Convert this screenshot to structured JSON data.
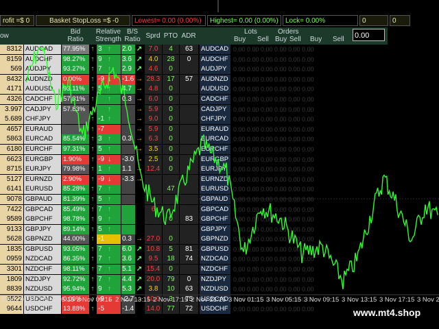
{
  "topbar": {
    "profit": "rofit =$ 0",
    "basket": "Basket StopLoss =$ -0",
    "lowest": "Lowest= 0.00 (0.00%)",
    "highest": "Highest= 0.00 (0.00%)",
    "lock": "Lock= 0.00%",
    "box1": "0",
    "box2": "0"
  },
  "header": {
    "ow": "ow",
    "bid": "Bid\nRatio",
    "rs": "Relative\nStrength",
    "bs": "B/S\nRatio",
    "sprd": "Sprd",
    "pto": "PTO",
    "adr": "ADR",
    "lots": "Lots",
    "orders": "Orders",
    "buy1": "Buy",
    "sell1": "Sell",
    "buy2": "Buy",
    "sell2": "Sell",
    "buy3": "Buy",
    "sell3": "Sell",
    "input_value": "0.00"
  },
  "colors": {
    "green": "#1db954",
    "red": "#e53935",
    "up": "#5cff5c",
    "down": "#ffd000"
  },
  "rows": [
    {
      "num": "8312",
      "sym": "AUDCAD",
      "bid": "77.95%",
      "bidc": "#7a7a7a",
      "rs": "3",
      "rsa": "↑",
      "rsc": "#1fa33a",
      "bs": "2.0",
      "bsc": "#1fa33a",
      "bsa": "↗",
      "sprd": "7.0",
      "sprdc": "#ff4040",
      "pto": "4",
      "ptoc": "#7dff5a",
      "adr": "63",
      "sym2": "AUDCAD",
      "z": "0.00   0.00   0.00   0.00   0.00   0.00"
    },
    {
      "num": "8159",
      "sym": "AUDCHF",
      "bid": "98.27%",
      "bidc": "#1fa33a",
      "rs": "9",
      "rsa": "↑",
      "rsc": "#1fa33a",
      "bs": "3.6",
      "bsc": "#1fa33a",
      "bsa": "↗",
      "sprd": "4.0",
      "sprdc": "#ffd000",
      "pto": "28",
      "ptoc": "#7dff5a",
      "adr": "0",
      "sym2": "AUDCHF",
      "z": "0.00   0.00   0.00   0.00   0.00   0.00"
    },
    {
      "num": "569",
      "sym": "AUDJPY",
      "bid": "93.27%",
      "bidc": "#1fa33a",
      "rs": "7",
      "rsa": "↑",
      "rsc": "#1fa33a",
      "bs": "2.9",
      "bsc": "#1fa33a",
      "bsa": "↗",
      "sprd": "4.6",
      "sprdc": "#ff4040",
      "pto": "0",
      "ptoc": "#7dff5a",
      "adr": "",
      "sym2": "AUDJPY",
      "z": "0.00   0.00   0.00   0.00   0.00   0.00"
    },
    {
      "num": "8432",
      "sym": "AUDNZD",
      "bid": "0.00%",
      "bidc": "#e53935",
      "rs": "-9",
      "rsa": "↓",
      "rsc": "#e53935",
      "bs": "-1.6",
      "bsc": "#e53935",
      "bsa": "→",
      "sprd": "28.3",
      "sprdc": "#ff4040",
      "pto": "17",
      "ptoc": "#7dff5a",
      "adr": "57",
      "sym2": "AUDNZD",
      "z": "0.00   0.00   0.00   0.00   0.00   0.00"
    },
    {
      "num": "4171",
      "sym": "AUDUSD",
      "bid": "93.11%",
      "bidc": "#1fa33a",
      "rs": "5",
      "rsa": "↑",
      "rsc": "#1fa33a",
      "bs": "4.7",
      "bsc": "#1fa33a",
      "bsa": "→",
      "sprd": "4.8",
      "sprdc": "#ff4040",
      "pto": "0",
      "ptoc": "#7dff5a",
      "adr": "",
      "sym2": "AUDUSD",
      "z": "0.00   0.00   0.00   0.00   0.00   0.00"
    },
    {
      "num": "4326",
      "sym": "CADCHF",
      "bid": "57.31%",
      "bidc": "#555555",
      "rs": "",
      "rsa": "↑",
      "rsc": "#1fa33a",
      "bs": "0.3",
      "bsc": "#444444",
      "bsa": "→",
      "sprd": "6.0",
      "sprdc": "#ff4040",
      "pto": "0",
      "ptoc": "#7dff5a",
      "adr": "",
      "sym2": "CADCHF",
      "z": "0.00   0.00   0.00   0.00   0.00   0.00"
    },
    {
      "num": "3.997",
      "sym": "CADJPY",
      "bid": "57.83%",
      "bidc": "#555555",
      "rs": "",
      "rsa": "↑",
      "rsc": "#1fa33a",
      "bs": "",
      "bsc": "#444444",
      "bsa": "→",
      "sprd": "5.9",
      "sprdc": "#ff4040",
      "pto": "0",
      "ptoc": "#7dff5a",
      "adr": "",
      "sym2": "CADJPY",
      "z": "0.00   0.00   0.00   0.00   0.00   0.00"
    },
    {
      "num": "5.689",
      "sym": "CHFJPY",
      "bid": "",
      "bidc": "#555555",
      "rs": "-1",
      "rsa": "↑",
      "rsc": "#1fa33a",
      "bs": "",
      "bsc": "#444444",
      "bsa": "→",
      "sprd": "9.0",
      "sprdc": "#ff4040",
      "pto": "0",
      "ptoc": "#7dff5a",
      "adr": "",
      "sym2": "CHFJPY",
      "z": "0.00   0.00   0.00   0.00   0.00   0.00"
    },
    {
      "num": "4657",
      "sym": "EURAUD",
      "bid": "",
      "bidc": "#555555",
      "rs": "-7",
      "rsa": "",
      "rsc": "#e53935",
      "bs": "",
      "bsc": "#444444",
      "bsa": "→",
      "sprd": "5.9",
      "sprdc": "#ff4040",
      "pto": "0",
      "ptoc": "#7dff5a",
      "adr": "",
      "sym2": "EURAUD",
      "z": "0.00   0.00   0.00   0.00   0.00   0.00"
    },
    {
      "num": "5863",
      "sym": "EURCAD",
      "bid": "85.54%",
      "bidc": "#1fa33a",
      "rs": "3",
      "rsa": "↑",
      "rsc": "#1fa33a",
      "bs": "0.3",
      "bsc": "#444444",
      "bsa": "→",
      "sprd": "6.3",
      "sprdc": "#ff4040",
      "pto": "0",
      "ptoc": "#7dff5a",
      "adr": "",
      "sym2": "EURCAD",
      "z": "0.00   0.00   0.00   0.00   0.00   0.00"
    },
    {
      "num": "6180",
      "sym": "EURCHF",
      "bid": "97.31%",
      "bidc": "#1fa33a",
      "rs": "5",
      "rsa": "↑",
      "rsc": "#1fa33a",
      "bs": "",
      "bsc": "#444444",
      "bsa": "→",
      "sprd": "3.5",
      "sprdc": "#ffd000",
      "pto": "0",
      "ptoc": "#7dff5a",
      "adr": "",
      "sym2": "EURCHF",
      "z": "0.00   0.00   0.00   0.00   0.00   0.00"
    },
    {
      "num": "6623",
      "sym": "EURGBP",
      "bid": "1.90%",
      "bidc": "#e53935",
      "rs": "-9",
      "rsa": "↓",
      "rsc": "#e53935",
      "bs": "-3.0",
      "bsc": "#444444",
      "bsa": "→",
      "sprd": "2.5",
      "sprdc": "#ffd000",
      "pto": "0",
      "ptoc": "#7dff5a",
      "adr": "",
      "sym2": "EURGBP",
      "z": "0.00   0.00   0.00   0.00   0.00   0.00"
    },
    {
      "num": "8715",
      "sym": "EURJPY",
      "bid": "79.98%",
      "bidc": "#555555",
      "rs": "1",
      "rsa": "↑",
      "rsc": "#1fa33a",
      "bs": "1.1",
      "bsc": "#444444",
      "bsa": "→",
      "sprd": "12.4",
      "sprdc": "#ff4040",
      "pto": "0",
      "ptoc": "#7dff5a",
      "adr": "",
      "sym2": "EURJPY",
      "z": "0.00   0.00   0.00   0.00   0.00   0.00"
    },
    {
      "num": "5127",
      "sym": "EURNZD",
      "bid": "2.90%",
      "bidc": "#e53935",
      "rs": "-9",
      "rsa": "↓",
      "rsc": "#e53935",
      "bs": "-3.3",
      "bsc": "#444444",
      "bsa": "→",
      "sprd": "",
      "sprdc": "#ff4040",
      "pto": "",
      "ptoc": "#7dff5a",
      "adr": "",
      "sym2": "EURNZD",
      "z": "0.00   0.00   0.00   0.00   0.00   0.00"
    },
    {
      "num": "6141",
      "sym": "EURUSD",
      "bid": "85.28%",
      "bidc": "#1fa33a",
      "rs": "7",
      "rsa": "↑",
      "rsc": "#1fa33a",
      "bs": "",
      "bsc": "#444444",
      "bsa": "",
      "sprd": "",
      "sprdc": "#ff4040",
      "pto": "47",
      "ptoc": "#7dff5a",
      "adr": "",
      "sym2": "EURUSD",
      "z": "0.00   0.00   0.00   0.00   0.00   0.00"
    },
    {
      "num": "9078",
      "sym": "GBPAUD",
      "bid": "81.39%",
      "bidc": "#1fa33a",
      "rs": "5",
      "rsa": "↑",
      "rsc": "#1fa33a",
      "bs": "",
      "bsc": "#444444",
      "bsa": "",
      "sprd": "",
      "sprdc": "#ff4040",
      "pto": "",
      "ptoc": "#7dff5a",
      "adr": "",
      "sym2": "GBPAUD",
      "z": "0.00   0.00   0.00   0.00   0.00   0.00"
    },
    {
      "num": "7422",
      "sym": "GBPCAD",
      "bid": "85.49%",
      "bidc": "#1fa33a",
      "rs": "7",
      "rsa": "↑",
      "rsc": "#1fa33a",
      "bs": "",
      "bsc": "#1fa33a",
      "bsa": "",
      "sprd": "6",
      "sprdc": "#ff4040",
      "pto": "",
      "ptoc": "#7dff5a",
      "adr": "",
      "sym2": "GBPCAD",
      "z": "0.00   0.00   0.00   0.00   0.00   0.00"
    },
    {
      "num": "9589",
      "sym": "GBPCHF",
      "bid": "98.78%",
      "bidc": "#1fa33a",
      "rs": "9",
      "rsa": "↑",
      "rsc": "#1fa33a",
      "bs": "",
      "bsc": "#1fa33a",
      "bsa": "",
      "sprd": "",
      "sprdc": "#ff4040",
      "pto": "0",
      "ptoc": "#7dff5a",
      "adr": "83",
      "sym2": "GBPCHF",
      "z": "0.00   0.00   0.00   0.00   0.00   0.00"
    },
    {
      "num": "9133",
      "sym": "GBPJPY",
      "bid": "89.14%",
      "bidc": "#1fa33a",
      "rs": "5",
      "rsa": "↑",
      "rsc": "#1fa33a",
      "bs": "",
      "bsc": "#1fa33a",
      "bsa": "",
      "sprd": "",
      "sprdc": "#ff4040",
      "pto": "",
      "ptoc": "#7dff5a",
      "adr": "",
      "sym2": "GBPJPY",
      "z": "0.00   0.00   0.00   0.00   0.00   0.00"
    },
    {
      "num": "5628",
      "sym": "GBPNZD",
      "bid": "44.00%",
      "bidc": "#555555",
      "rs": "-1",
      "rsa": "→",
      "rsc": "#e8c000",
      "bs": "0.3",
      "bsc": "#444444",
      "bsa": "→",
      "sprd": "27.0",
      "sprdc": "#ff4040",
      "pto": "0",
      "ptoc": "#7dff5a",
      "adr": "",
      "sym2": "GBPNZD",
      "z": "0.00   0.00   0.00   0.00   0.00   0.00"
    },
    {
      "num": "1835",
      "sym": "GBPUSD",
      "bid": "93.05%",
      "bidc": "#1fa33a",
      "rs": "7",
      "rsa": "↑",
      "rsc": "#1fa33a",
      "bs": "6.0",
      "bsc": "#1fa33a",
      "bsa": "↗",
      "sprd": "10.8",
      "sprdc": "#ff4040",
      "pto": "5",
      "ptoc": "#7dff5a",
      "adr": "81",
      "sym2": "GBPUSD",
      "z": "0.00   0.00   0.00   0.00   0.00   0.00"
    },
    {
      "num": "0959",
      "sym": "NZDCAD",
      "bid": "86.35%",
      "bidc": "#1fa33a",
      "rs": "7",
      "rsa": "↑",
      "rsc": "#1fa33a",
      "bs": "3.6",
      "bsc": "#1fa33a",
      "bsa": "↗",
      "sprd": "9.5",
      "sprdc": "#ff4040",
      "pto": "18",
      "ptoc": "#7dff5a",
      "adr": "74",
      "sym2": "NZDCAD",
      "z": "0.00   0.00   0.00   0.00   0.00   0.00"
    },
    {
      "num": "3301",
      "sym": "NZDCHF",
      "bid": "98.11%",
      "bidc": "#1fa33a",
      "rs": "7",
      "rsa": "↑",
      "rsc": "#1fa33a",
      "bs": "5.1",
      "bsc": "#1fa33a",
      "bsa": "↗",
      "sprd": "15.4",
      "sprdc": "#ff4040",
      "pto": "0",
      "ptoc": "#7dff5a",
      "adr": "",
      "sym2": "NZDCHF",
      "z": "0.00   0.00   0.00   0.00   0.00   0.00"
    },
    {
      "num": "1809",
      "sym": "NZDJPY",
      "bid": "92.72%",
      "bidc": "#1fa33a",
      "rs": "7",
      "rsa": "↑",
      "rsc": "#1fa33a",
      "bs": "4.4",
      "bsc": "#1fa33a",
      "bsa": "↗",
      "sprd": "20.0",
      "sprdc": "#ff4040",
      "pto": "79",
      "ptoc": "#7dff5a",
      "adr": "0",
      "sym2": "NZDJPY",
      "z": "0.00   0.00   0.00   0.00   0.00   0.00"
    },
    {
      "num": "8839",
      "sym": "NZDUSD",
      "bid": "95.94%",
      "bidc": "#1fa33a",
      "rs": "9",
      "rsa": "↑",
      "rsc": "#1fa33a",
      "bs": "5.3",
      "bsc": "#1fa33a",
      "bsa": "↗",
      "sprd": "3.8",
      "sprdc": "#ffd000",
      "pto": "10",
      "ptoc": "#7dff5a",
      "adr": "63",
      "sym2": "NZDUSD",
      "z": "0.00   0.00   0.00   0.00   0.00   0.00"
    },
    {
      "num": "6522",
      "sym": "USDCAD",
      "bid": "0.09%",
      "bidc": "#e53935",
      "rs": "-9",
      "rsa": "↓",
      "rsc": "#e53935",
      "bs": "-2.7",
      "bsc": "#444444",
      "bsa": "→",
      "sprd": "10.0",
      "sprdc": "#ff4040",
      "pto": "3",
      "ptoc": "#7dff5a",
      "adr": "75",
      "sym2": "USDCAD",
      "z": "0.00   0.00   0.00   0.00   0.00   0.00"
    },
    {
      "num": "9644",
      "sym": "USDCHF",
      "bid": "13.88%",
      "bidc": "#e53935",
      "rs": "-5",
      "rsa": "",
      "rsc": "#e53935",
      "bs": "-1.4",
      "bsc": "#444444",
      "bsa": "",
      "sprd": "14.0",
      "sprdc": "#ff4040",
      "pto": "77",
      "ptoc": "#7dff5a",
      "adr": "72",
      "sym2": "USDCHF",
      "z": "0.00   0.00   0.00   0.00   0.00   0.00"
    }
  ],
  "xaxis": [
    "2 Nov 01:15",
    "2 Nov 05:15",
    "2 Nov 09:15",
    "2 Nov 13:15",
    "2 Nov 17:15",
    "2 Nov 21:15",
    "3 Nov 01:15",
    "3 Nov 05:15",
    "3 Nov 09:15",
    "3 Nov 13:15",
    "3 Nov 17:15",
    "3 Nov 2"
  ],
  "watermark": "www.mt4.shop"
}
